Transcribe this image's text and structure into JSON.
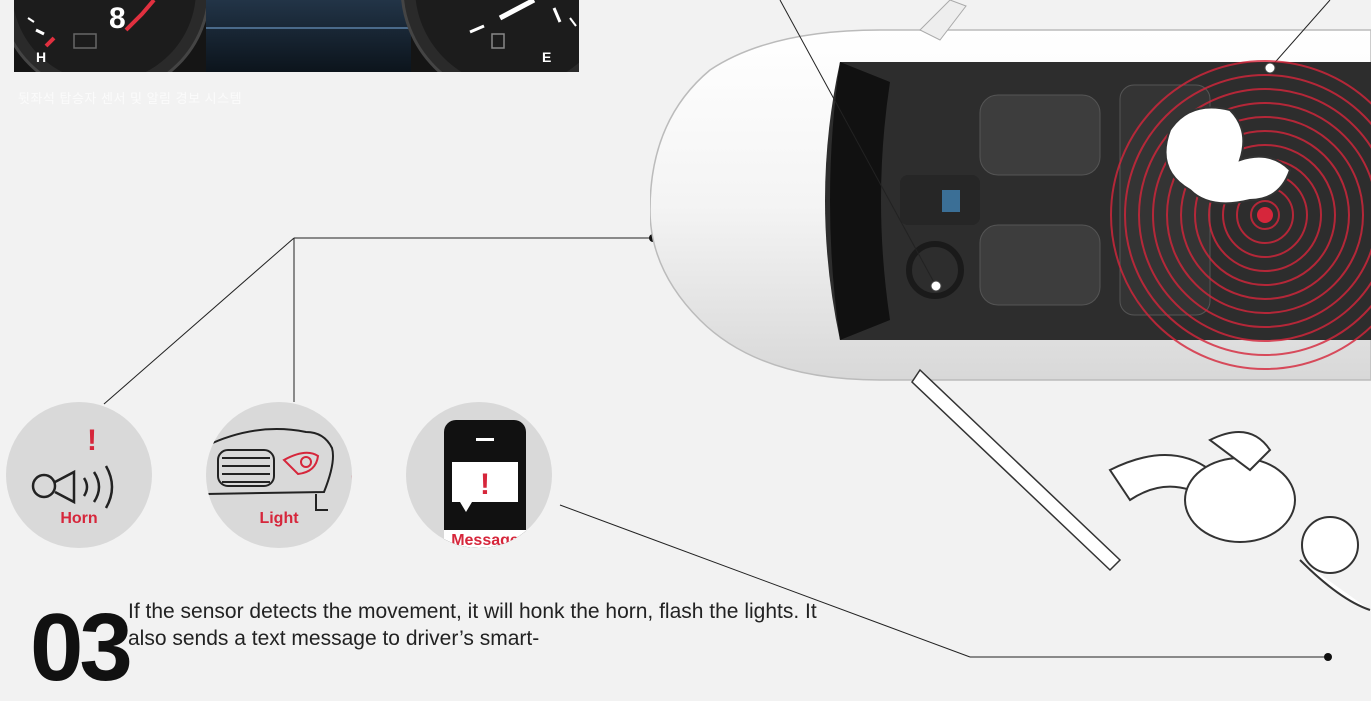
{
  "dashboard": {
    "temp_gauge_value": "8",
    "temp_label": "H",
    "fuel_label": "E",
    "caption": "뒷좌석 탑승자 센서 및 알림 경보 시스템"
  },
  "alerts": {
    "horn_label": "Horn",
    "light_label": "Light",
    "message_label": "Message",
    "alert_mark": "!"
  },
  "step": {
    "number": "03",
    "text": "If the sensor detects the movement, it will honk the horn, flash the lights. It also sends a text message to driver’s smart-"
  },
  "colors": {
    "accent": "#d6263b",
    "background": "#f2f2f2",
    "circle": "#d9d9d9",
    "line": "#222222"
  }
}
